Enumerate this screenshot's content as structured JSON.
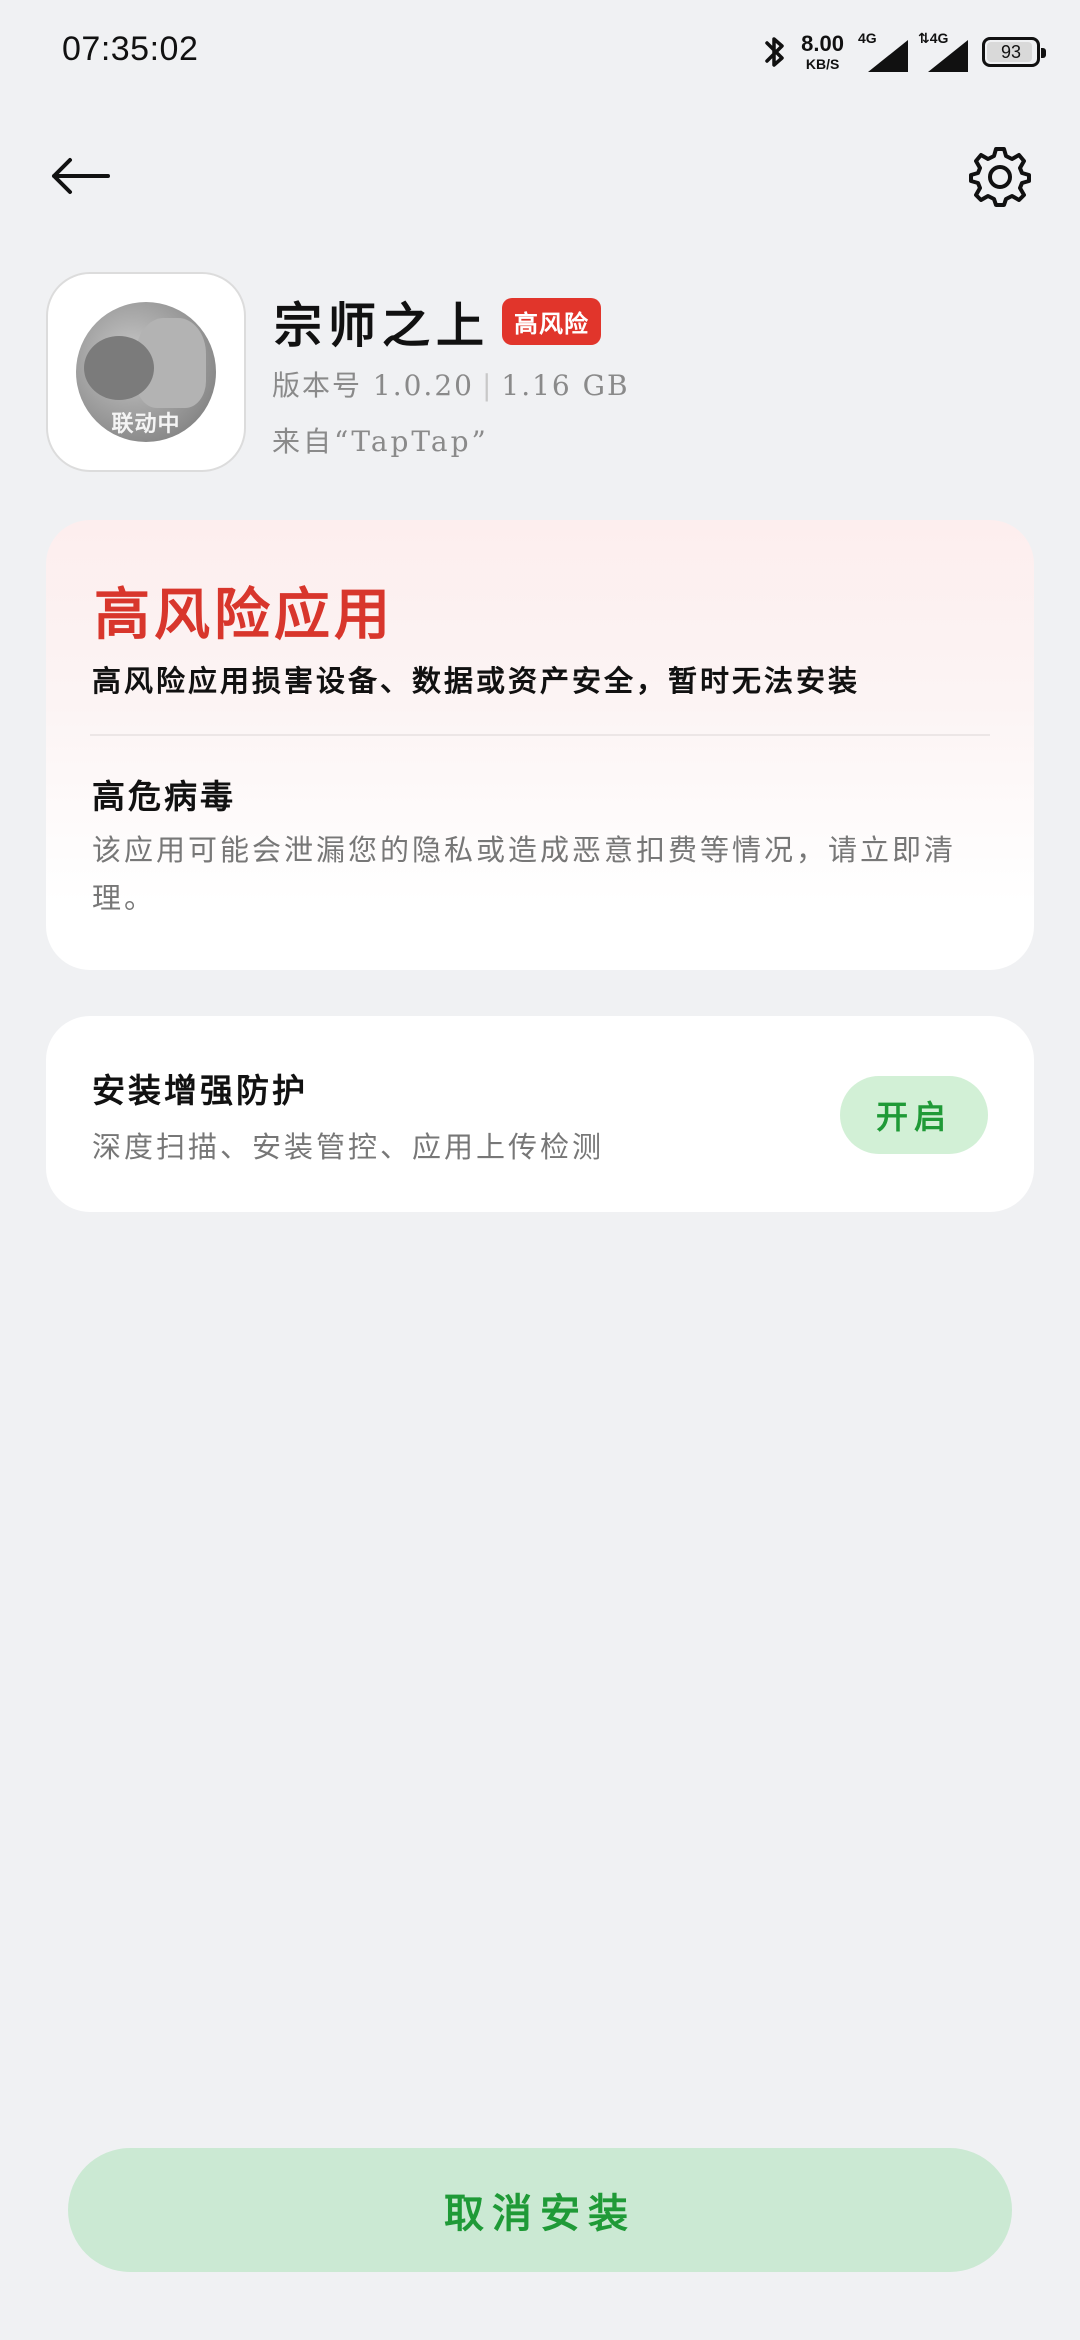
{
  "status_bar": {
    "time": "07:35:02",
    "net_speed_value": "8.00",
    "net_speed_unit": "KB/S",
    "signal1_label": "4G",
    "signal2_label": "⇅4G",
    "battery_level": "93",
    "icons": [
      "bluetooth-icon",
      "signal-icon",
      "signal-icon",
      "battery-icon"
    ]
  },
  "header": {
    "back_icon": "back-arrow-icon",
    "settings_icon": "gear-icon"
  },
  "app": {
    "name": "宗师之上",
    "risk_badge": "高风险",
    "version_label": "版本号 1.0.20",
    "size": "1.16 GB",
    "source": "来自“TapTap”",
    "icon_caption": "联动中"
  },
  "risk_card": {
    "title": "高风险应用",
    "description": "高风险应用损害设备、数据或资产安全，暂时无法安装",
    "virus_title": "高危病毒",
    "virus_description": "该应用可能会泄漏您的隐私或造成恶意扣费等情况，请立即清理。"
  },
  "protection": {
    "title": "安装增强防护",
    "description": "深度扫描、安装管控、应用上传检测",
    "enable_label": "开启"
  },
  "footer": {
    "cancel_label": "取消安装"
  },
  "colors": {
    "background": "#f0f1f3",
    "risk_red": "#d8362c",
    "badge_red": "#e1352b",
    "accent_green": "#1f9a37",
    "button_green_bg": "#cbe9d3"
  }
}
